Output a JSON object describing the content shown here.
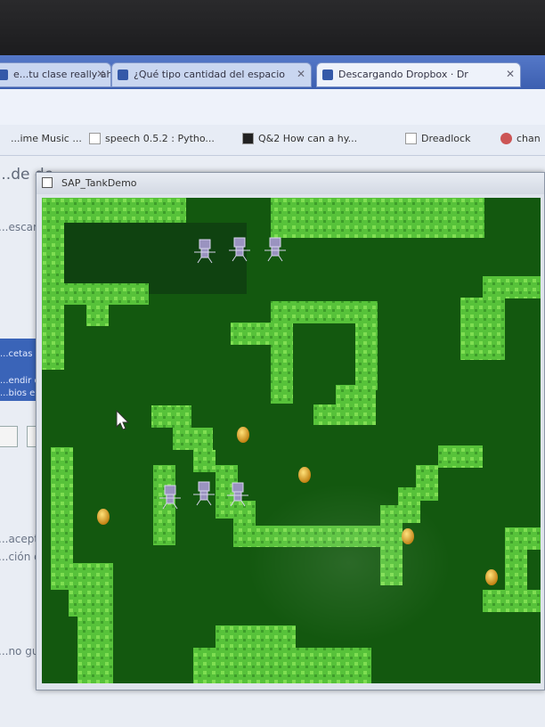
{
  "browser": {
    "tabs": [
      {
        "label": "e...tu clase really ah"
      },
      {
        "label": "¿Qué tipo cantidad del espacio"
      },
      {
        "label": "Descargando Dropbox · Dr"
      }
    ],
    "bookmarks": [
      {
        "label": "...ime Music ..."
      },
      {
        "label": "speech 0.5.2 : Pytho..."
      },
      {
        "label": "Q&2 How can a hy..."
      },
      {
        "label": "Dreadlock"
      },
      {
        "label": "chan"
      }
    ]
  },
  "page_behind": {
    "heading": "...de de",
    "lines": [
      "...escar",
      "...cetas de",
      "...endir qu",
      "...bios en",
      "...aceptar",
      "...ción del",
      "...no gust"
    ]
  },
  "app_window": {
    "title": "SAP_TankDemo"
  },
  "game": {
    "colors": {
      "background": "#13580f",
      "wall": "#57c23a",
      "wall_light": "#7fde52",
      "enemy": "#9a93c0",
      "coin": "#e3a92a"
    },
    "enemy_groups": [
      {
        "count": 3,
        "group": "top"
      },
      {
        "count": 3,
        "group": "middle"
      }
    ],
    "coin_count": 5
  }
}
